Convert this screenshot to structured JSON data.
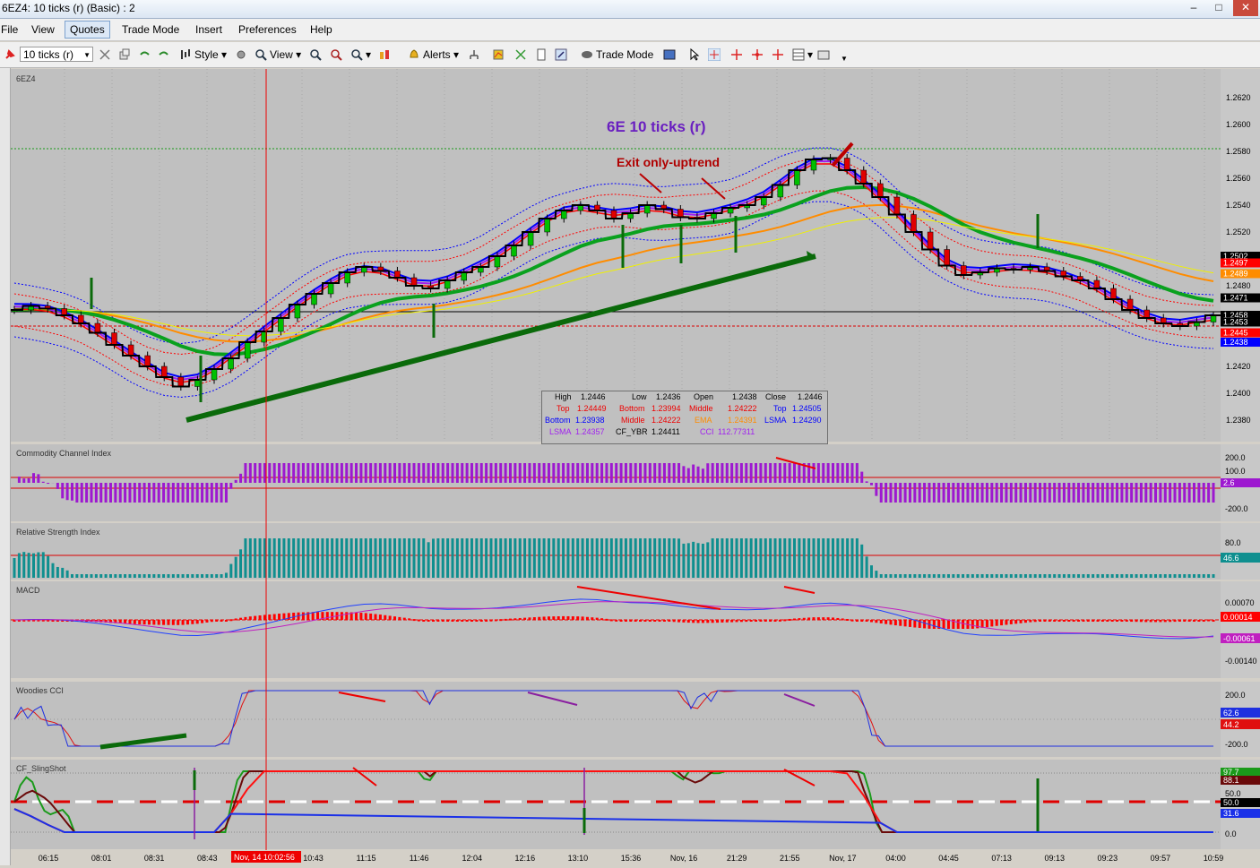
{
  "window": {
    "title": "6EZ4: 10 ticks (r) (Basic) : 2"
  },
  "menu": [
    "File",
    "View",
    "Quotes",
    "Trade Mode",
    "Insert",
    "Preferences",
    "Help"
  ],
  "toolbar": {
    "interval": "10 ticks (r)",
    "style_label": "Style",
    "view_label": "View",
    "alerts_label": "Alerts",
    "trade_mode_label": "Trade Mode"
  },
  "colors": {
    "background": "#c0c0c0",
    "price_line": "#000000",
    "ema": "#ff8c00",
    "lsma": "#a020f0",
    "green_ma": "#0aa11e",
    "blue_band": "#0000ff",
    "red_band": "#ff0000",
    "cci_bar": "#9d18d0",
    "rsi_bar": "#0f8f8f",
    "macd_hist": "#ff0000"
  },
  "main_chart": {
    "symbol": "6EZ4",
    "title": "6E 10 ticks (r)",
    "annotation": "Exit only-uptrend",
    "cursor_time": "Nov, 14 10:02:56",
    "y_ticks": [
      "1.2620",
      "1.2600",
      "1.2580",
      "1.2560",
      "1.2540",
      "1.2520",
      "1.2480",
      "1.2420",
      "1.2400",
      "1.2380"
    ],
    "price_tags": [
      {
        "text": "1.2502",
        "bg": "#000000",
        "fg": "#ffffff"
      },
      {
        "text": "1.2497",
        "bg": "#ff0000",
        "fg": "#ffffff"
      },
      {
        "text": "1.2489",
        "bg": "#ff8c00",
        "fg": "#ffffff"
      },
      {
        "text": "1.2471",
        "bg": "#000000",
        "fg": "#ffffff"
      },
      {
        "text": "1.2458",
        "bg": "#000000",
        "fg": "#ffffff"
      },
      {
        "text": "1.2453",
        "bg": "#000000",
        "fg": "#ffffff"
      },
      {
        "text": "1.2445",
        "bg": "#ff0000",
        "fg": "#ffffff"
      },
      {
        "text": "1.2438",
        "bg": "#0000ff",
        "fg": "#ffffff"
      }
    ]
  },
  "ohlc_box": {
    "high_label": "High",
    "high": "1.2446",
    "low_label": "Low",
    "low": "1.2436",
    "open_label": "Open",
    "open": "1.2438",
    "close_label": "Close",
    "close": "1.2446",
    "top_label": "Top",
    "top": "1.24449",
    "bottom_label": "Bottom",
    "bottom": "1.23994",
    "middle_label": "Middle",
    "middle": "1.24222",
    "top2_label": "Top",
    "top2": "1.24505",
    "bottom2_label": "Bottom",
    "bottom2": "1.23938",
    "middle2_label": "Middle",
    "middle2": "1.24222",
    "ema_label": "EMA",
    "ema": "1.24391",
    "lsma_label": "LSMA",
    "lsma": "1.24290",
    "lsma2_label": "LSMA",
    "lsma2": "1.24357",
    "cfybr_label": "CF_YBR",
    "cfybr": "1.24411",
    "cci_label": "CCI",
    "cci": "112.77311"
  },
  "panels": {
    "cci": {
      "title": "Commodity Channel Index",
      "ticks": [
        "200.0",
        "100.0",
        "-200.0"
      ],
      "tag": "2.6"
    },
    "rsi": {
      "title": "Relative Strength Index",
      "ticks": [
        "80.0"
      ],
      "tag": "46.6"
    },
    "macd": {
      "title": "MACD",
      "ticks": [
        "0.00070",
        "-0.00140"
      ],
      "tag1": "0.00014",
      "tag2": "-0.00061"
    },
    "woodies": {
      "title": "Woodies CCI",
      "ticks": [
        "200.0",
        "-200.0"
      ],
      "tag1": "62.6",
      "tag2": "44.2"
    },
    "sling": {
      "title": "CF_SlingShot",
      "ticks": [
        "50.0",
        "0.0"
      ],
      "tag1": "97.7",
      "tag2": "88.1",
      "tag3": "50.0",
      "tag4": "31.6"
    }
  },
  "x_axis": [
    "06:15",
    "08:01",
    "08:31",
    "08:43",
    "10:34",
    "10:43",
    "11:15",
    "11:46",
    "12:04",
    "12:16",
    "13:10",
    "15:36",
    "Nov, 16",
    "21:29",
    "21:55",
    "Nov, 17",
    "04:00",
    "04:45",
    "07:13",
    "09:13",
    "09:23",
    "09:57",
    "10:59"
  ],
  "chart_data": {
    "type": "candlestick",
    "title": "6E 10 ticks (r)",
    "close": [
      1.2462,
      1.2465,
      1.2463,
      1.2458,
      1.2452,
      1.2445,
      1.2436,
      1.2428,
      1.242,
      1.2412,
      1.2405,
      1.241,
      1.2418,
      1.2426,
      1.2438,
      1.2446,
      1.2456,
      1.2466,
      1.2474,
      1.2482,
      1.249,
      1.2494,
      1.2491,
      1.2486,
      1.248,
      1.2478,
      1.2484,
      1.249,
      1.2494,
      1.2502,
      1.251,
      1.252,
      1.253,
      1.2536,
      1.254,
      1.2536,
      1.253,
      1.2534,
      1.254,
      1.2537,
      1.2531,
      1.253,
      1.2534,
      1.2538,
      1.254,
      1.2546,
      1.2555,
      1.2566,
      1.2574,
      1.2575,
      1.2566,
      1.2556,
      1.2546,
      1.2533,
      1.252,
      1.2507,
      1.2495,
      1.2488,
      1.249,
      1.2493,
      1.2492,
      1.2494,
      1.2491,
      1.2487,
      1.2484,
      1.2478,
      1.247,
      1.2462,
      1.2456,
      1.2452,
      1.245,
      1.2453,
      1.2458
    ]
  }
}
